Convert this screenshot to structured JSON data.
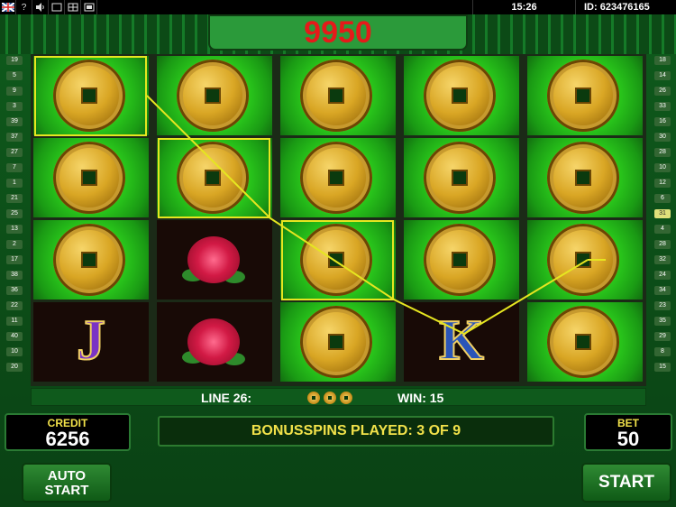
{
  "top_bar": {
    "flag_icon": "uk-flag-icon",
    "help_label": "?",
    "sound_icon": "speaker-icon",
    "time": "15:26",
    "id_text": "ID: 623476165"
  },
  "jackpot_value": "9950",
  "reels": [
    [
      "coin",
      "coin",
      "coin",
      "J"
    ],
    [
      "coin",
      "coin",
      "flower",
      "flower"
    ],
    [
      "coin",
      "coin",
      "coin",
      "coin"
    ],
    [
      "coin",
      "coin",
      "coin",
      "K"
    ],
    [
      "coin",
      "coin",
      "coin",
      "coin"
    ]
  ],
  "line_numbers_left": [
    "19",
    "5",
    "9",
    "3",
    "39",
    "37",
    "27",
    "7",
    "1",
    "21",
    "25",
    "13",
    "2",
    "17",
    "38",
    "36",
    "22",
    "11",
    "40",
    "10",
    "20"
  ],
  "line_numbers_right": [
    "18",
    "14",
    "26",
    "33",
    "16",
    "30",
    "28",
    "10",
    "12",
    "6",
    "31",
    "4",
    "28",
    "32",
    "24",
    "34",
    "23",
    "35",
    "29",
    "8",
    "15"
  ],
  "info_bar": {
    "line_text": "LINE 26:",
    "win_text": "WIN: 15"
  },
  "credit": {
    "label": "CREDIT",
    "value": "6256"
  },
  "bonus_text": "BONUSSPINS PLAYED: 3 OF 9",
  "bet": {
    "label": "BET",
    "value": "50"
  },
  "buttons": {
    "auto_start_line1": "AUTO",
    "auto_start_line2": "START",
    "start": "START"
  },
  "colors": {
    "jackpot": "#e51a1a",
    "highlight": "#e6e620",
    "bonus_text": "#f2e24a"
  }
}
